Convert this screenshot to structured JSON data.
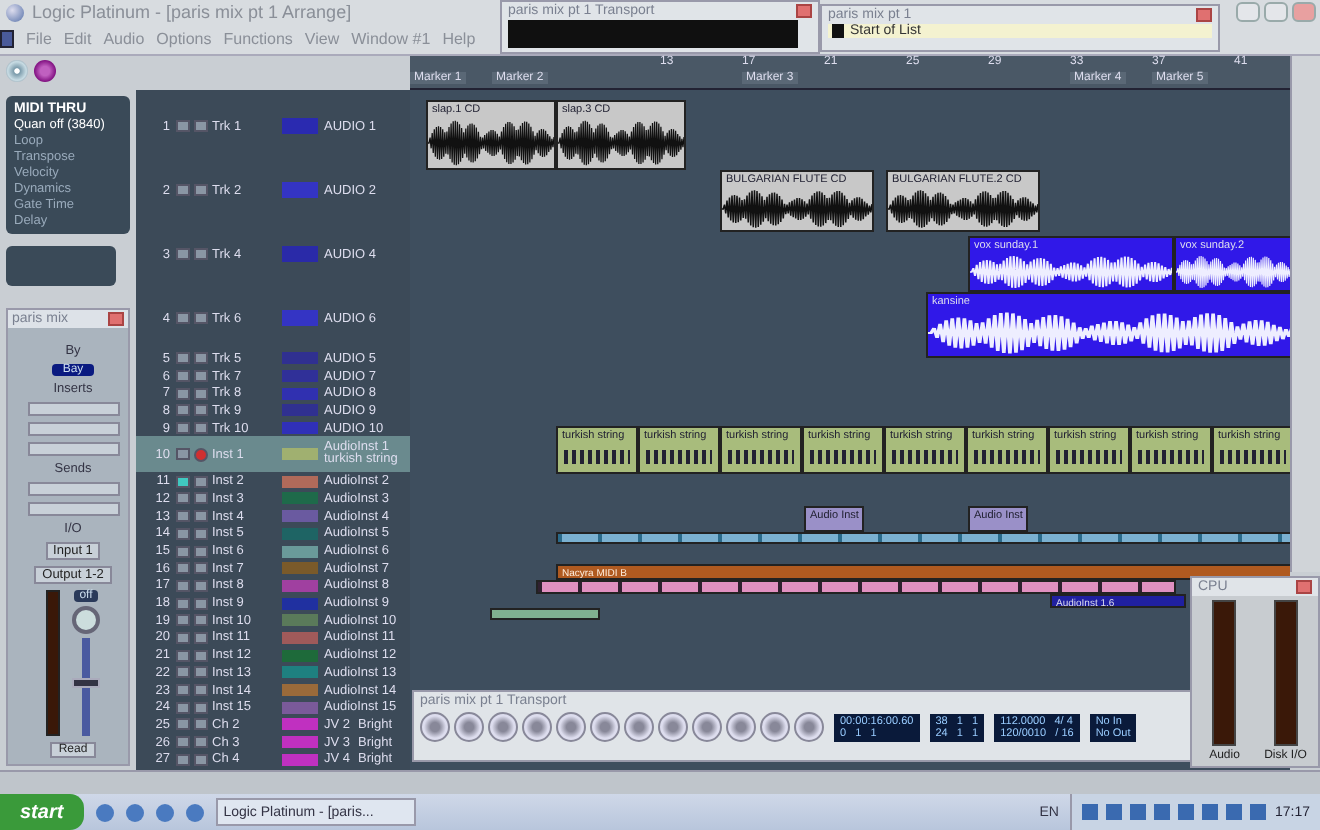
{
  "window": {
    "title": "Logic Platinum - [paris mix pt 1 Arrange]"
  },
  "menu": [
    "File",
    "Edit",
    "Audio",
    "Options",
    "Functions",
    "View",
    "Window #1",
    "Help"
  ],
  "top_transport": {
    "title": "paris mix pt 1 Transport"
  },
  "event_list": {
    "title": "paris mix pt 1",
    "entry": "Start of List"
  },
  "inspector": {
    "title": "MIDI THRU",
    "quantize": "Quan  off (3840)",
    "params": [
      "Loop",
      "Transpose",
      "Velocity",
      "Dynamics",
      "Gate Time",
      "Delay"
    ]
  },
  "mixer": {
    "title": "paris mix",
    "by": "By",
    "bay": "Bay",
    "inserts": "Inserts",
    "sends": "Sends",
    "io": "I/O",
    "input": "Input 1",
    "output": "Output 1-2",
    "off": "off",
    "fader": {
      "level": 0.55
    },
    "mode": "Read"
  },
  "ruler": {
    "bars": [
      "13",
      "17",
      "21",
      "25",
      "29",
      "33",
      "37",
      "41"
    ],
    "markers": [
      "Marker 1",
      "Marker 2",
      "Marker 3",
      "Marker 4",
      "Marker 5"
    ]
  },
  "tracks": [
    {
      "number": "1",
      "name": "Trk 1",
      "instrument": "AUDIO 1",
      "color": "#2a2ab0",
      "kind": "large",
      "selected": false,
      "mute": false,
      "record": false
    },
    {
      "number": "2",
      "name": "Trk 2",
      "instrument": "AUDIO 2",
      "color": "#3434c4",
      "kind": "large",
      "selected": false,
      "mute": false,
      "record": false
    },
    {
      "number": "3",
      "name": "Trk 4",
      "instrument": "AUDIO 4",
      "color": "#2a2aa8",
      "kind": "large",
      "selected": false,
      "mute": false,
      "record": false
    },
    {
      "number": "4",
      "name": "Trk 6",
      "instrument": "AUDIO 6",
      "color": "#3434c4",
      "kind": "large",
      "selected": false,
      "mute": false,
      "record": false
    },
    {
      "number": "5",
      "name": "Trk 5",
      "instrument": "AUDIO 5",
      "color": "#303090",
      "kind": "small",
      "selected": false,
      "mute": false,
      "record": false
    },
    {
      "number": "6",
      "name": "Trk 7",
      "instrument": "AUDIO 7",
      "color": "#303098",
      "kind": "small",
      "selected": false,
      "mute": false,
      "record": false
    },
    {
      "number": "7",
      "name": "Trk 8",
      "instrument": "AUDIO 8",
      "color": "#3030b0",
      "kind": "small",
      "selected": false,
      "mute": false,
      "record": false
    },
    {
      "number": "8",
      "name": "Trk 9",
      "instrument": "AUDIO 9",
      "color": "#303090",
      "kind": "small",
      "selected": false,
      "mute": false,
      "record": false
    },
    {
      "number": "9",
      "name": "Trk 10",
      "instrument": "AUDIO 10",
      "color": "#3030b8",
      "kind": "small",
      "selected": false,
      "mute": false,
      "record": false
    },
    {
      "number": "10",
      "name": "Inst 1",
      "instrument": "AudioInst  1",
      "subtitle": "turkish string",
      "color": "#a0b070",
      "kind": "tall",
      "selected": true,
      "mute": false,
      "record": true
    },
    {
      "number": "11",
      "name": "Inst 2",
      "instrument": "AudioInst  2",
      "color": "#b06a5a",
      "kind": "small",
      "selected": false,
      "mute": true,
      "record": false
    },
    {
      "number": "12",
      "name": "Inst 3",
      "instrument": "AudioInst  3",
      "color": "#1e6a4a",
      "kind": "small",
      "selected": false,
      "mute": false,
      "record": false
    },
    {
      "number": "13",
      "name": "Inst 4",
      "instrument": "AudioInst  4",
      "color": "#6a5aa0",
      "kind": "small",
      "selected": false,
      "mute": false,
      "record": false
    },
    {
      "number": "14",
      "name": "Inst 5",
      "instrument": "AudioInst  5",
      "color": "#1e6464",
      "kind": "small",
      "selected": false,
      "mute": false,
      "record": false
    },
    {
      "number": "15",
      "name": "Inst 6",
      "instrument": "AudioInst  6",
      "color": "#6a9a9a",
      "kind": "small",
      "selected": false,
      "mute": false,
      "record": false
    },
    {
      "number": "16",
      "name": "Inst 7",
      "instrument": "AudioInst  7",
      "color": "#7a5a2a",
      "kind": "small",
      "selected": false,
      "mute": false,
      "record": false
    },
    {
      "number": "17",
      "name": "Inst 8",
      "instrument": "AudioInst  8",
      "color": "#a040a0",
      "kind": "small",
      "selected": false,
      "mute": false,
      "record": false
    },
    {
      "number": "18",
      "name": "Inst 9",
      "instrument": "AudioInst  9",
      "color": "#2030a0",
      "kind": "small",
      "selected": false,
      "mute": false,
      "record": false
    },
    {
      "number": "19",
      "name": "Inst 10",
      "instrument": "AudioInst 10",
      "color": "#5a7a5a",
      "kind": "small",
      "selected": false,
      "mute": false,
      "record": false
    },
    {
      "number": "20",
      "name": "Inst 11",
      "instrument": "AudioInst 11",
      "color": "#a05a5a",
      "kind": "small",
      "selected": false,
      "mute": false,
      "record": false
    },
    {
      "number": "21",
      "name": "Inst 12",
      "instrument": "AudioInst 12",
      "color": "#1e6a3a",
      "kind": "small",
      "selected": false,
      "mute": false,
      "record": false
    },
    {
      "number": "22",
      "name": "Inst 13",
      "instrument": "AudioInst 13",
      "color": "#1e8080",
      "kind": "small",
      "selected": false,
      "mute": false,
      "record": false
    },
    {
      "number": "23",
      "name": "Inst 14",
      "instrument": "AudioInst 14",
      "color": "#9a6a3a",
      "kind": "small",
      "selected": false,
      "mute": false,
      "record": false
    },
    {
      "number": "24",
      "name": "Inst 15",
      "instrument": "AudioInst 15",
      "color": "#7a5a9a",
      "kind": "small",
      "selected": false,
      "mute": false,
      "record": false
    },
    {
      "number": "25",
      "name": "Ch 2",
      "instrument": "JV 2",
      "subtitle": "Bright",
      "color": "#c030c0",
      "kind": "small",
      "selected": false,
      "mute": false,
      "record": false
    },
    {
      "number": "26",
      "name": "Ch 3",
      "instrument": "JV 3",
      "subtitle": "Bright",
      "color": "#c030c0",
      "kind": "small",
      "selected": false,
      "mute": false,
      "record": false
    },
    {
      "number": "27",
      "name": "Ch 4",
      "instrument": "JV 4",
      "subtitle": "Bright",
      "color": "#c030c0",
      "kind": "small",
      "selected": false,
      "mute": false,
      "record": false
    }
  ],
  "regions": [
    {
      "kind": "audio",
      "label": "slap.1  CD"
    },
    {
      "kind": "audio",
      "label": "slap.3  CD"
    },
    {
      "kind": "audio",
      "label": "BULGARIAN FLUTE  CD"
    },
    {
      "kind": "audio",
      "label": "BULGARIAN FLUTE.2  CD"
    },
    {
      "kind": "vox",
      "label": "vox sunday.1"
    },
    {
      "kind": "vox",
      "label": "vox sunday.2"
    },
    {
      "kind": "vox",
      "label": "kansine"
    },
    {
      "kind": "strings",
      "label": "turkish  string"
    },
    {
      "kind": "strings",
      "label": "turkish  string"
    },
    {
      "kind": "strings",
      "label": "turkish  string"
    },
    {
      "kind": "strings",
      "label": "turkish  string"
    },
    {
      "kind": "strings",
      "label": "turkish  string"
    },
    {
      "kind": "strings",
      "label": "turkish  string"
    },
    {
      "kind": "strings",
      "label": "turkish  string"
    },
    {
      "kind": "strings",
      "label": "turkish  string"
    },
    {
      "kind": "strings",
      "label": "turkish  string"
    },
    {
      "kind": "inst",
      "label": "Audio Inst"
    },
    {
      "kind": "inst",
      "label": "Audio Inst"
    },
    {
      "kind": "strip-cyan"
    },
    {
      "kind": "band",
      "label": "Nacyra MIDI B"
    },
    {
      "kind": "strip-pink"
    },
    {
      "kind": "small-blue",
      "label": "AudioInst 1.6"
    },
    {
      "kind": "small-green"
    }
  ],
  "transport": {
    "title": "paris mix pt 1 Transport",
    "displays": [
      [
        "00:00:16:00.60",
        "0   1   1"
      ],
      [
        "38   1   1",
        "24   1   1"
      ],
      [
        "112.0000   4/ 4",
        "120/0010   / 16"
      ],
      [
        "No In",
        "No Out"
      ]
    ]
  },
  "cpu": {
    "title": "CPU",
    "meters": [
      "Audio",
      "Disk I/O"
    ]
  },
  "taskbar": {
    "start": "start",
    "task": "Logic Platinum - [paris...",
    "language": "EN",
    "clock": "17:17"
  }
}
